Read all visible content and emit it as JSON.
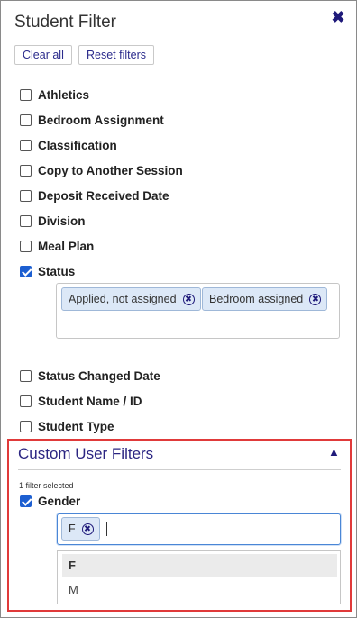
{
  "header": {
    "title": "Student Filter",
    "close_icon": "close-icon"
  },
  "buttons": {
    "clear_all": "Clear all",
    "reset_filters": "Reset filters"
  },
  "filters": [
    {
      "label": "Athletics",
      "checked": false
    },
    {
      "label": "Bedroom Assignment",
      "checked": false
    },
    {
      "label": "Classification",
      "checked": false
    },
    {
      "label": "Copy to Another Session",
      "checked": false
    },
    {
      "label": "Deposit Received Date",
      "checked": false
    },
    {
      "label": "Division",
      "checked": false
    },
    {
      "label": "Meal Plan",
      "checked": false
    },
    {
      "label": "Status",
      "checked": true
    },
    {
      "label": "Status Changed Date",
      "checked": false
    },
    {
      "label": "Student Name / ID",
      "checked": false
    },
    {
      "label": "Student Type",
      "checked": false
    }
  ],
  "status_tags": [
    "Applied, not assigned",
    "Bedroom assigned"
  ],
  "custom": {
    "title": "Custom User Filters",
    "collapse_icon": "chevron-up-icon",
    "count_text": "1 filter selected",
    "gender": {
      "label": "Gender",
      "checked": true,
      "tags": [
        "F"
      ]
    },
    "dropdown_options": [
      {
        "label": "F",
        "selected": true
      },
      {
        "label": "M",
        "selected": false
      }
    ]
  },
  "colors": {
    "accent": "#1f1a7a",
    "checkbox": "#1d5fd1",
    "highlight_border": "#e03a3a",
    "tag_bg": "#dce8f7"
  }
}
